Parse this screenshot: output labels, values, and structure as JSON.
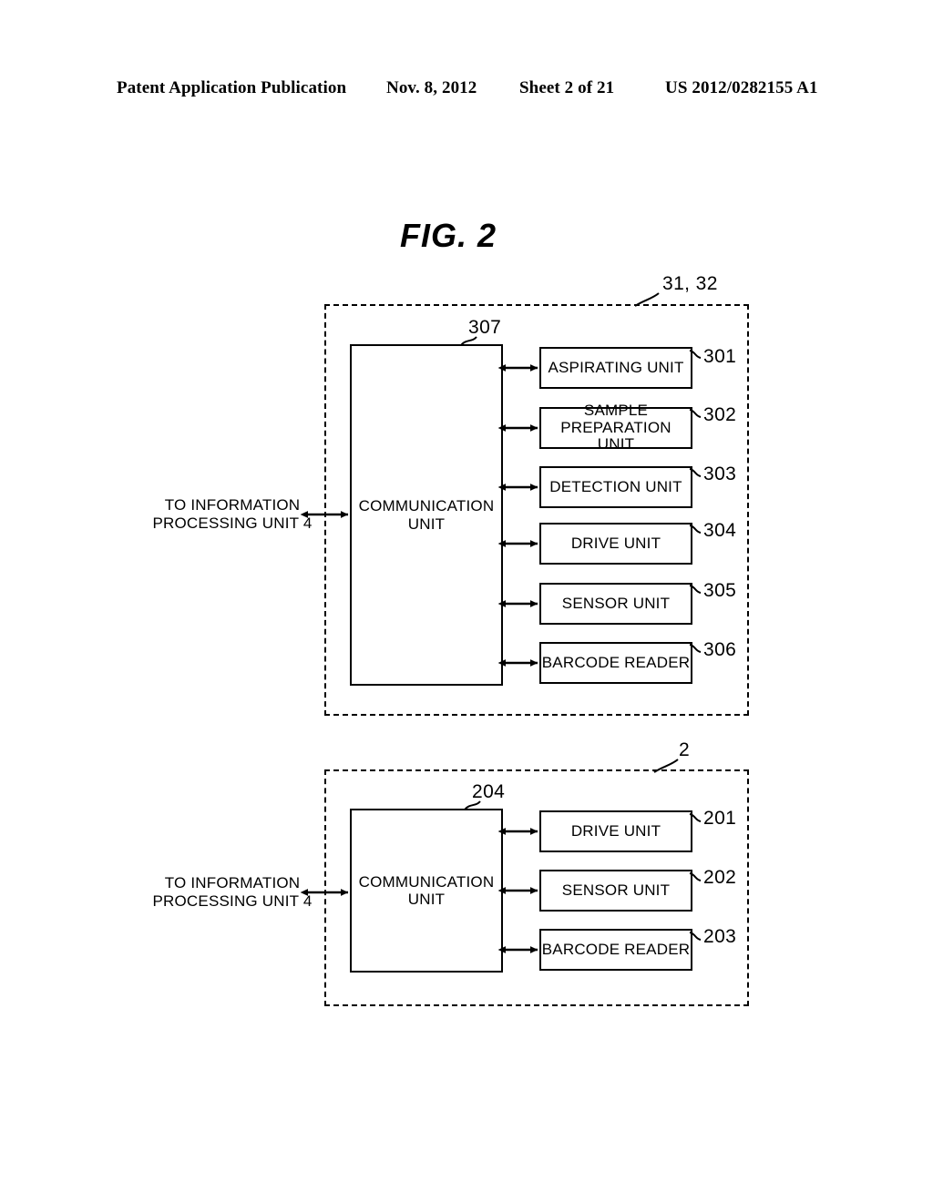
{
  "header": {
    "left": "Patent Application Publication",
    "date": "Nov. 8, 2012",
    "sheet": "Sheet 2 of 21",
    "doc_number": "US 2012/0282155 A1"
  },
  "figure": {
    "title": "FIG. 2"
  },
  "diagram_upper": {
    "region_ref": "31, 32",
    "external_label": "TO INFORMATION\nPROCESSING UNIT 4",
    "external_label_line1": "TO INFORMATION",
    "external_label_line2": "PROCESSING UNIT 4",
    "communication_unit": {
      "label_line1": "COMMUNICATION",
      "label_line2": "UNIT",
      "ref": "307"
    },
    "units": [
      {
        "label": "ASPIRATING UNIT",
        "ref": "301",
        "lines": [
          "ASPIRATING UNIT"
        ]
      },
      {
        "label": "SAMPLE PREPARATION UNIT",
        "ref": "302",
        "lines": [
          "SAMPLE",
          "PREPARATION UNIT"
        ]
      },
      {
        "label": "DETECTION UNIT",
        "ref": "303",
        "lines": [
          "DETECTION UNIT"
        ]
      },
      {
        "label": "DRIVE UNIT",
        "ref": "304",
        "lines": [
          "DRIVE UNIT"
        ]
      },
      {
        "label": "SENSOR UNIT",
        "ref": "305",
        "lines": [
          "SENSOR UNIT"
        ]
      },
      {
        "label": "BARCODE READER",
        "ref": "306",
        "lines": [
          "BARCODE READER"
        ]
      }
    ]
  },
  "diagram_lower": {
    "region_ref": "2",
    "external_label_line1": "TO INFORMATION",
    "external_label_line2": "PROCESSING UNIT 4",
    "communication_unit": {
      "label_line1": "COMMUNICATION",
      "label_line2": "UNIT",
      "ref": "204"
    },
    "units": [
      {
        "label": "DRIVE UNIT",
        "ref": "201",
        "lines": [
          "DRIVE UNIT"
        ]
      },
      {
        "label": "SENSOR UNIT",
        "ref": "202",
        "lines": [
          "SENSOR UNIT"
        ]
      },
      {
        "label": "BARCODE READER",
        "ref": "203",
        "lines": [
          "BARCODE READER"
        ]
      }
    ]
  }
}
